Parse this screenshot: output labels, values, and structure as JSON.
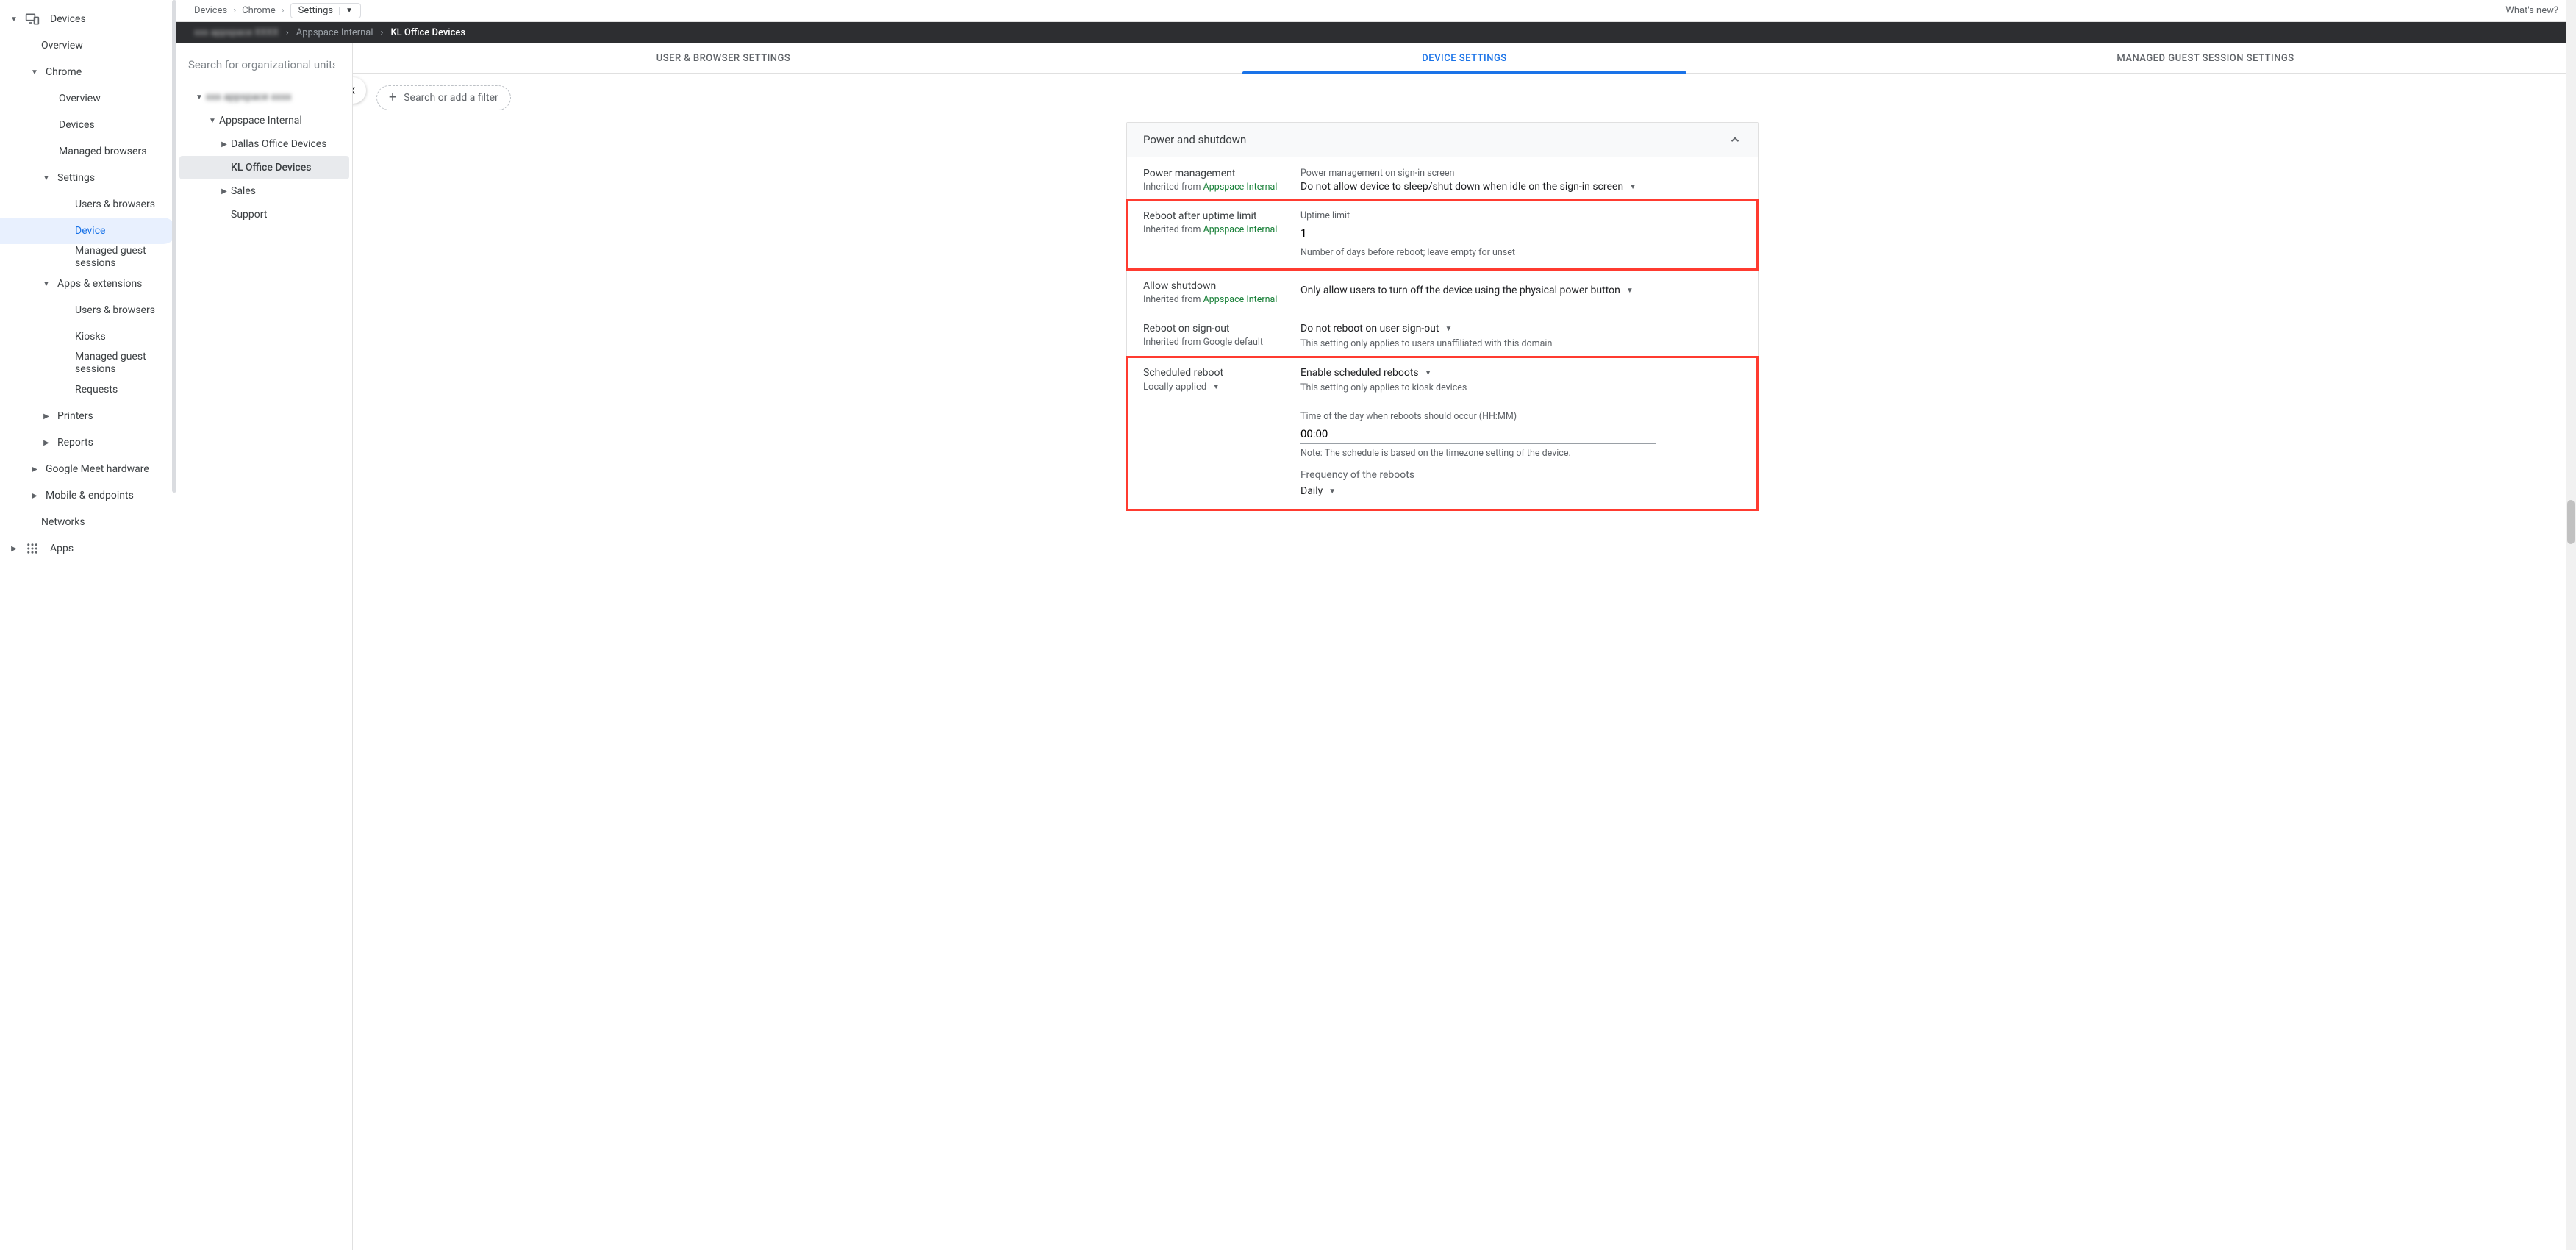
{
  "breadcrumb": {
    "items": [
      "Devices",
      "Chrome"
    ],
    "settings_label": "Settings",
    "whats_new": "What's new?"
  },
  "dark_bar": {
    "blurred": "xxx appspace XXXX",
    "items": [
      "Appspace Internal"
    ],
    "current": "KL Office Devices"
  },
  "left_nav": {
    "devices": "Devices",
    "overview": "Overview",
    "chrome": "Chrome",
    "chrome_overview": "Overview",
    "chrome_devices": "Devices",
    "managed_browsers": "Managed browsers",
    "settings": "Settings",
    "users_browsers": "Users & browsers",
    "device": "Device",
    "managed_guest": "Managed guest sessions",
    "apps_ext": "Apps & extensions",
    "ae_users": "Users & browsers",
    "kiosks": "Kiosks",
    "ae_guest": "Managed guest sessions",
    "requests": "Requests",
    "printers": "Printers",
    "reports": "Reports",
    "gmeet": "Google Meet hardware",
    "mobile": "Mobile & endpoints",
    "networks": "Networks",
    "apps": "Apps"
  },
  "ou": {
    "search_ph": "Search for organizational units",
    "root": "xxx appspace xxxx",
    "internal": "Appspace Internal",
    "dallas": "Dallas Office Devices",
    "kl": "KL Office Devices",
    "sales": "Sales",
    "support": "Support"
  },
  "tabs": {
    "t1": "USER & BROWSER SETTINGS",
    "t2": "DEVICE SETTINGS",
    "t3": "MANAGED GUEST SESSION SETTINGS"
  },
  "filter": {
    "chip": "Search or add a filter"
  },
  "card": {
    "title": "Power and shutdown",
    "pm": {
      "name": "Power management",
      "inherit_pre": "Inherited from ",
      "inherit_link": "Appspace Internal",
      "sub": "Power management on sign-in screen",
      "value": "Do not allow device to sleep/shut down when idle on the sign-in screen"
    },
    "reboot": {
      "name": "Reboot after uptime limit",
      "inherit_pre": "Inherited from ",
      "inherit_link": "Appspace Internal",
      "field_label": "Uptime limit",
      "value": "1",
      "help": "Number of days before reboot; leave empty for unset"
    },
    "shutdown": {
      "name": "Allow shutdown",
      "inherit_pre": "Inherited from ",
      "inherit_link": "Appspace Internal",
      "value": "Only allow users to turn off the device using the physical power button"
    },
    "signout": {
      "name": "Reboot on sign-out",
      "inherit": "Inherited from Google default",
      "value": "Do not reboot on user sign-out",
      "help": "This setting only applies to users unaffiliated with this domain"
    },
    "sched": {
      "name": "Scheduled reboot",
      "local": "Locally applied",
      "value": "Enable scheduled reboots",
      "help": "This setting only applies to kiosk devices",
      "time_label": "Time of the day when reboots should occur (HH:MM)",
      "time_value": "00:00",
      "time_note": "Note: The schedule is based on the timezone setting of the device.",
      "freq_label": "Frequency of the reboots",
      "freq_value": "Daily"
    }
  }
}
